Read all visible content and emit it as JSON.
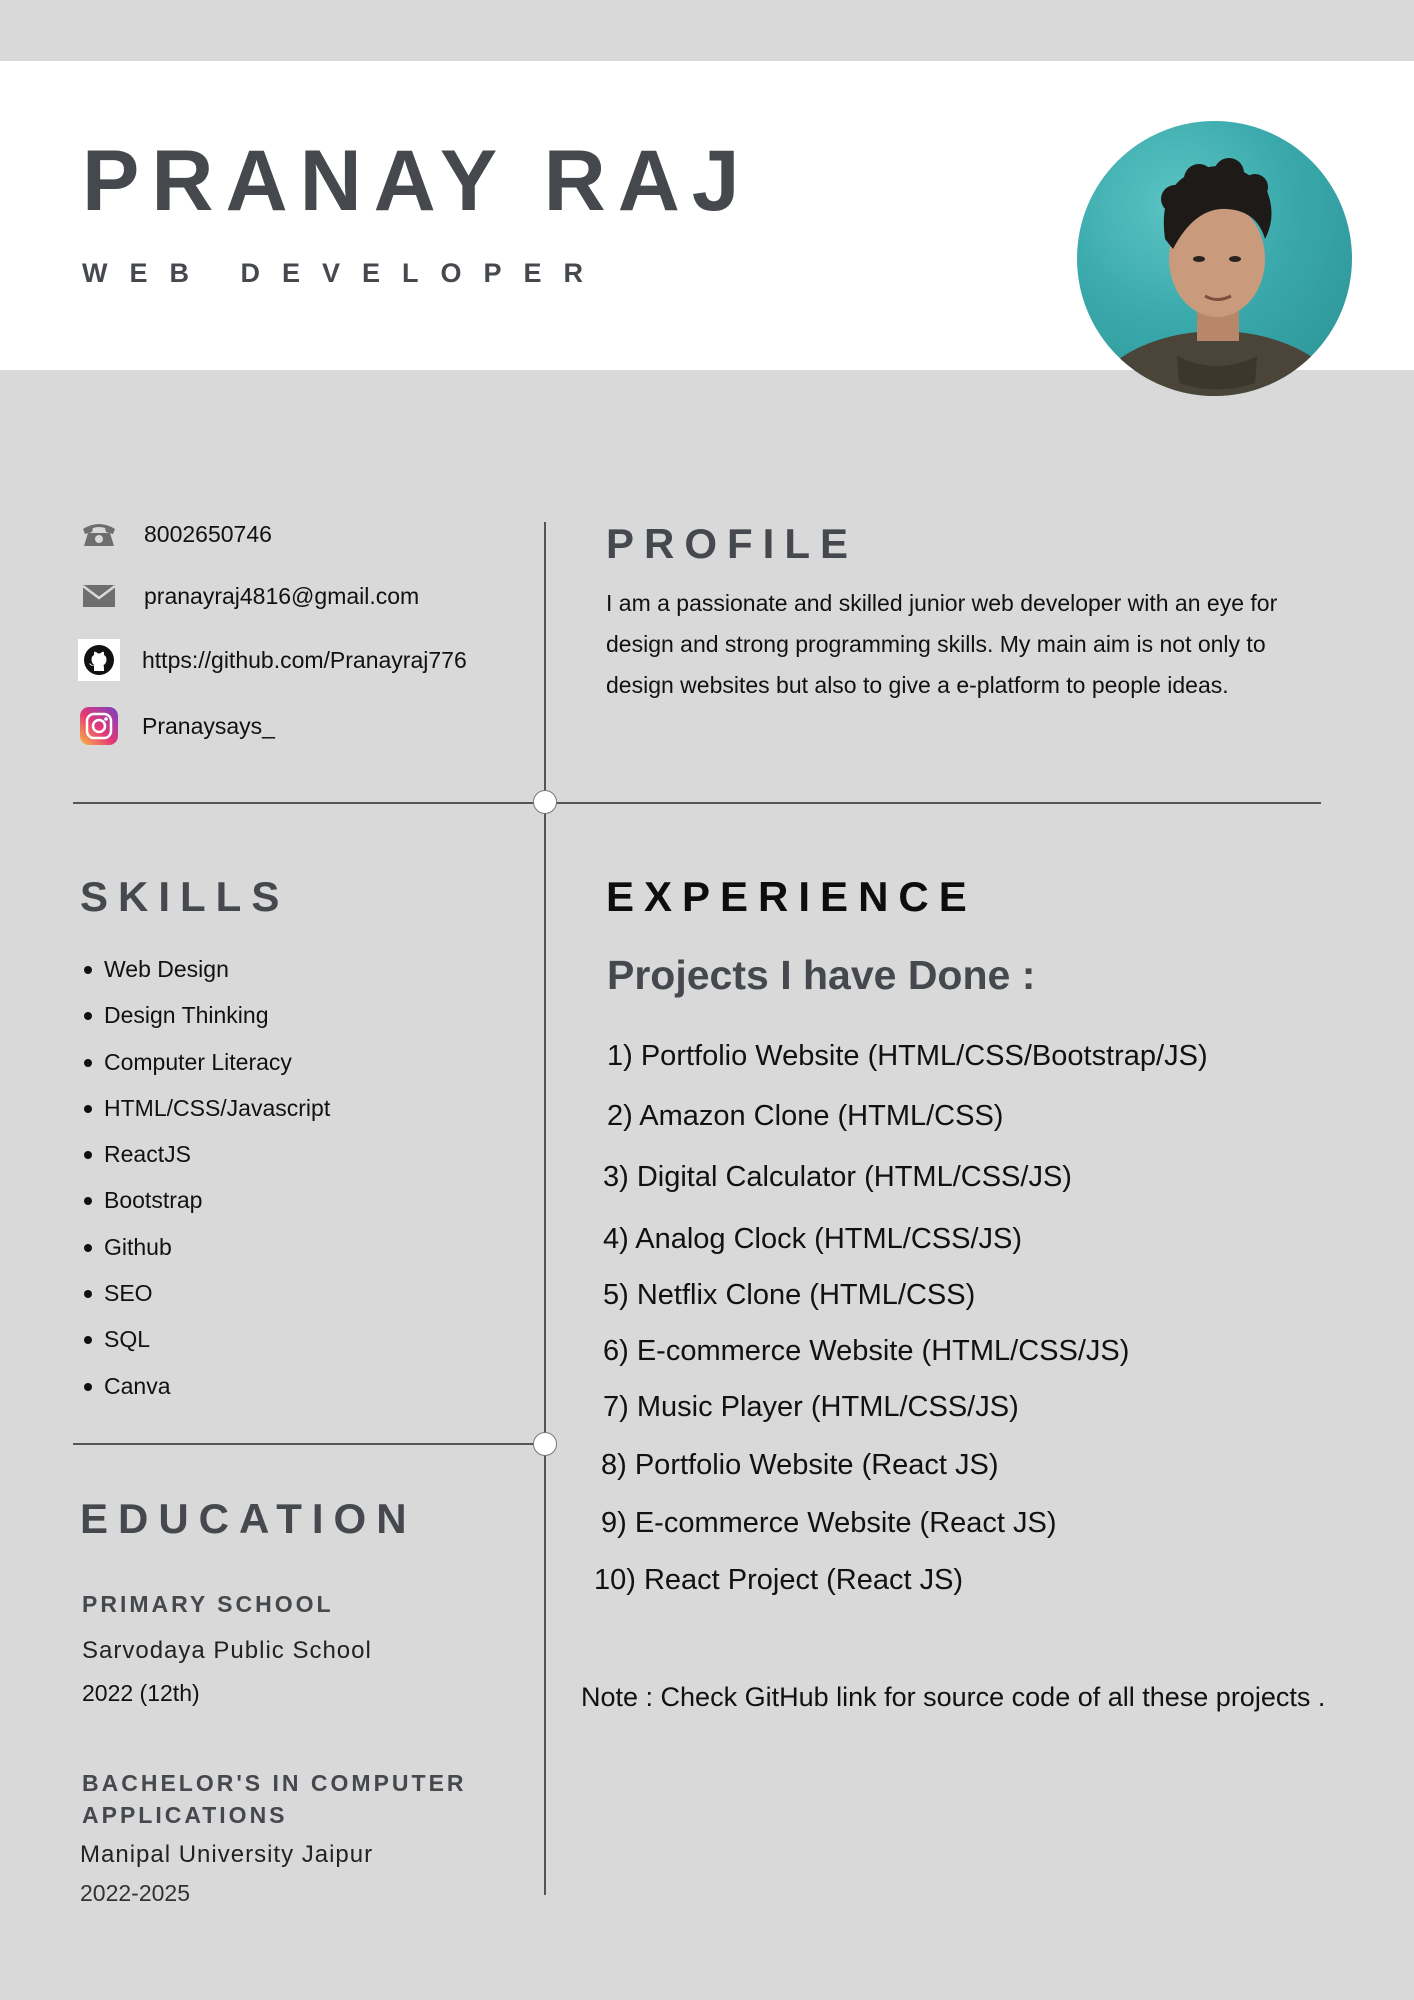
{
  "header": {
    "name": "PRANAY RAJ",
    "role": "WEB DEVELOPER"
  },
  "contact": {
    "phone": "8002650746",
    "email": "pranayraj4816@gmail.com",
    "github": "https://github.com/Pranayraj776",
    "instagram": "Pranaysays_"
  },
  "profile": {
    "title": "PROFILE",
    "text": "I am a passionate and skilled junior web developer with an eye for design and strong programming skills. My main aim is not only to design websites but also to give a e-platform to people ideas."
  },
  "skills": {
    "title": "SKILLS",
    "items": [
      "Web Design",
      "Design Thinking",
      "Computer Literacy",
      "HTML/CSS/Javascript",
      "ReactJS",
      "Bootstrap",
      "Github",
      "SEO",
      "SQL",
      "Canva"
    ]
  },
  "experience": {
    "title": "EXPERIENCE",
    "projects_heading": "Projects I have Done :",
    "projects": [
      "1) Portfolio Website (HTML/CSS/Bootstrap/JS)",
      "2) Amazon Clone (HTML/CSS)",
      "3) Digital Calculator (HTML/CSS/JS)",
      "4) Analog Clock (HTML/CSS/JS)",
      "5) Netflix Clone (HTML/CSS)",
      "6) E-commerce Website (HTML/CSS/JS)",
      "7) Music  Player (HTML/CSS/JS)",
      "8)  Portfolio Website (React JS)",
      "9) E-commerce Website (React JS)",
      "10) React Project (React JS)"
    ],
    "note": "Note : Check GitHub  link for  source code of all these projects ."
  },
  "education": {
    "title": "EDUCATION",
    "entries": [
      {
        "heading": "PRIMARY SCHOOL",
        "institution": "Sarvodaya Public School",
        "year": "2022 (12th)"
      },
      {
        "heading": "BACHELOR'S IN COMPUTER APPLICATIONS",
        "institution": "Manipal University Jaipur",
        "year": "2022-2025"
      }
    ]
  },
  "icons": {
    "phone": "phone-icon",
    "email": "envelope-icon",
    "github": "github-icon",
    "instagram": "instagram-icon"
  },
  "colors": {
    "background": "#d9d9d9",
    "header_band": "#ffffff",
    "heading_gray": "#45484d",
    "avatar_teal": "#3aa9ab"
  }
}
